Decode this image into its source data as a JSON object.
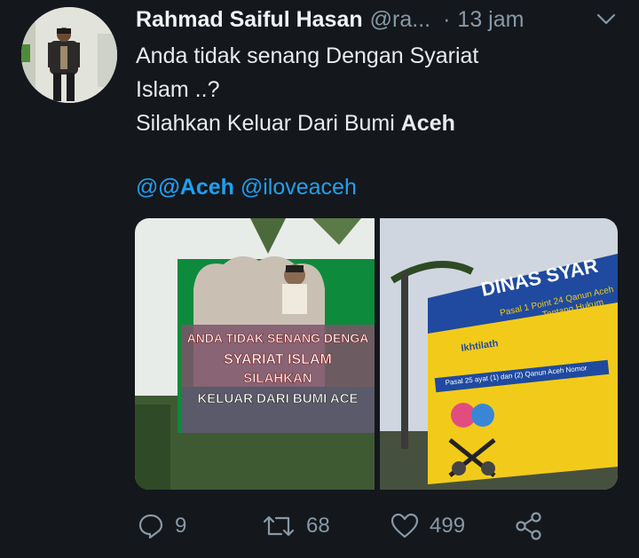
{
  "tweet": {
    "author_name": "Rahmad Saiful Hasan",
    "author_handle": "@ra...",
    "separator": "·",
    "time": "13 jam",
    "text_lines": [
      "Anda tidak senang Dengan Syariat",
      "Islam ..?"
    ],
    "text_line3_prefix": "Silahkan Keluar Dari Bumi ",
    "text_line3_bold": "Aceh",
    "mention_hashtag": "@Aceh",
    "mention_handle": "@iloveaceh"
  },
  "media": {
    "photo1": {
      "line1": "ANDA TIDAK SENANG DENGA",
      "line2": "SYARIAT ISLAM",
      "line3": "SILAHKAN",
      "line4": "KELUAR DARI BUMI ACE"
    },
    "photo2": {
      "title": "DINAS SYAR",
      "subtitle1": "Pasal 1 Point 24 Qanun Aceh",
      "subtitle2": "Tentang Hukum",
      "term": "Ikhtilath",
      "section": "Pasal 25 ayat (1) dan (2) Qanun Aceh Nomor"
    }
  },
  "actions": {
    "reply_count": "9",
    "retweet_count": "68",
    "like_count": "499"
  },
  "icons": [
    "chevron-down-icon",
    "reply-icon",
    "retweet-icon",
    "like-icon",
    "share-icon"
  ],
  "colors": {
    "background": "#14171c",
    "link": "#1da1f2",
    "secondary_text": "#8899a6"
  }
}
